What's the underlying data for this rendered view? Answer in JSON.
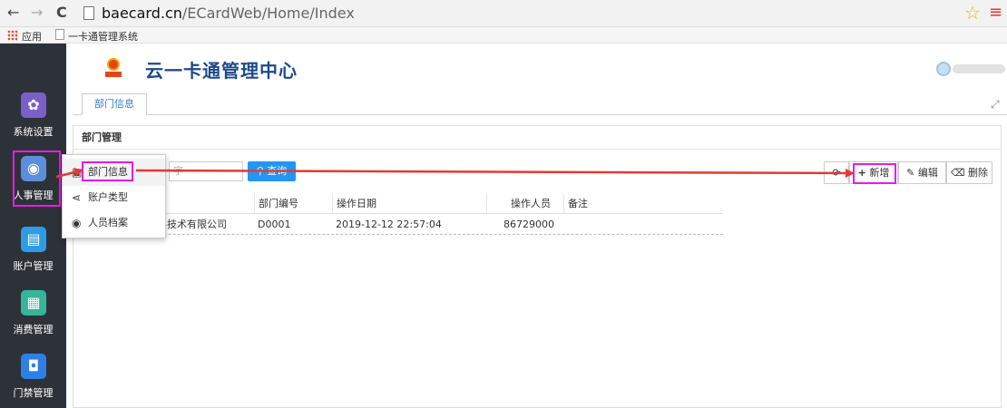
{
  "browser": {
    "back": "←",
    "forward": "→",
    "reload": "C",
    "url_host": "baecard.cn",
    "url_path": "/ECardWeb/Home/Index",
    "bookmark_apps": "应用",
    "bookmark_1": "一卡通管理系统"
  },
  "sidebar": {
    "items": [
      {
        "label": "系统设置",
        "icon": "gear-icon",
        "color": "#7b5fc9",
        "glyph": "✿"
      },
      {
        "label": "人事管理",
        "icon": "person-icon",
        "color": "#5b8fd9",
        "glyph": "◉"
      },
      {
        "label": "账户管理",
        "icon": "id-card-icon",
        "color": "#2e9be6",
        "glyph": "▤"
      },
      {
        "label": "消费管理",
        "icon": "calculator-icon",
        "color": "#34b59c",
        "glyph": "▦"
      },
      {
        "label": "门禁管理",
        "icon": "lock-icon",
        "color": "#2e7fe6",
        "glyph": "🔒"
      }
    ]
  },
  "header": {
    "title": "云一卡通管理中心"
  },
  "tabs": [
    {
      "label": "部门信息"
    }
  ],
  "panel": {
    "title": "部门管理",
    "search_placeholder": "字",
    "search_button": "查询",
    "toolbar": {
      "refresh": "⟳",
      "add": "新增",
      "edit": "编辑",
      "delete": "删除"
    }
  },
  "table": {
    "columns": [
      "",
      "部门编号",
      "操作日期",
      "操作人员",
      "备注"
    ],
    "rows": [
      [
        "科技术有限公司",
        "D0001",
        "2019-12-12 22:57:04",
        "86729000",
        ""
      ]
    ]
  },
  "dropdown": {
    "items": [
      {
        "label": "部门信息",
        "icon": "list-icon",
        "glyph": "▣"
      },
      {
        "label": "账户类型",
        "icon": "share-icon",
        "glyph": "⋖"
      },
      {
        "label": "人员档案",
        "icon": "user-circle-icon",
        "glyph": "◉"
      }
    ]
  },
  "colors": {
    "highlight": "#e91ae9",
    "arrow": "#e53935",
    "accent": "#2196f3"
  }
}
